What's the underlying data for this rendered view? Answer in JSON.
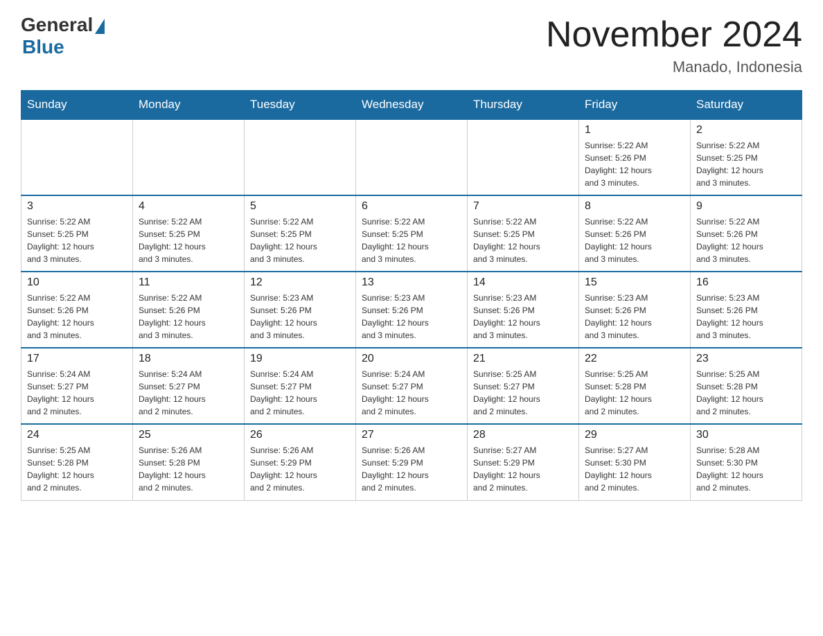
{
  "logo": {
    "general": "General",
    "blue": "Blue"
  },
  "title": {
    "month_year": "November 2024",
    "location": "Manado, Indonesia"
  },
  "header_days": [
    "Sunday",
    "Monday",
    "Tuesday",
    "Wednesday",
    "Thursday",
    "Friday",
    "Saturday"
  ],
  "weeks": [
    {
      "days": [
        {
          "num": "",
          "info": ""
        },
        {
          "num": "",
          "info": ""
        },
        {
          "num": "",
          "info": ""
        },
        {
          "num": "",
          "info": ""
        },
        {
          "num": "",
          "info": ""
        },
        {
          "num": "1",
          "info": "Sunrise: 5:22 AM\nSunset: 5:26 PM\nDaylight: 12 hours\nand 3 minutes."
        },
        {
          "num": "2",
          "info": "Sunrise: 5:22 AM\nSunset: 5:25 PM\nDaylight: 12 hours\nand 3 minutes."
        }
      ]
    },
    {
      "days": [
        {
          "num": "3",
          "info": "Sunrise: 5:22 AM\nSunset: 5:25 PM\nDaylight: 12 hours\nand 3 minutes."
        },
        {
          "num": "4",
          "info": "Sunrise: 5:22 AM\nSunset: 5:25 PM\nDaylight: 12 hours\nand 3 minutes."
        },
        {
          "num": "5",
          "info": "Sunrise: 5:22 AM\nSunset: 5:25 PM\nDaylight: 12 hours\nand 3 minutes."
        },
        {
          "num": "6",
          "info": "Sunrise: 5:22 AM\nSunset: 5:25 PM\nDaylight: 12 hours\nand 3 minutes."
        },
        {
          "num": "7",
          "info": "Sunrise: 5:22 AM\nSunset: 5:25 PM\nDaylight: 12 hours\nand 3 minutes."
        },
        {
          "num": "8",
          "info": "Sunrise: 5:22 AM\nSunset: 5:26 PM\nDaylight: 12 hours\nand 3 minutes."
        },
        {
          "num": "9",
          "info": "Sunrise: 5:22 AM\nSunset: 5:26 PM\nDaylight: 12 hours\nand 3 minutes."
        }
      ]
    },
    {
      "days": [
        {
          "num": "10",
          "info": "Sunrise: 5:22 AM\nSunset: 5:26 PM\nDaylight: 12 hours\nand 3 minutes."
        },
        {
          "num": "11",
          "info": "Sunrise: 5:22 AM\nSunset: 5:26 PM\nDaylight: 12 hours\nand 3 minutes."
        },
        {
          "num": "12",
          "info": "Sunrise: 5:23 AM\nSunset: 5:26 PM\nDaylight: 12 hours\nand 3 minutes."
        },
        {
          "num": "13",
          "info": "Sunrise: 5:23 AM\nSunset: 5:26 PM\nDaylight: 12 hours\nand 3 minutes."
        },
        {
          "num": "14",
          "info": "Sunrise: 5:23 AM\nSunset: 5:26 PM\nDaylight: 12 hours\nand 3 minutes."
        },
        {
          "num": "15",
          "info": "Sunrise: 5:23 AM\nSunset: 5:26 PM\nDaylight: 12 hours\nand 3 minutes."
        },
        {
          "num": "16",
          "info": "Sunrise: 5:23 AM\nSunset: 5:26 PM\nDaylight: 12 hours\nand 3 minutes."
        }
      ]
    },
    {
      "days": [
        {
          "num": "17",
          "info": "Sunrise: 5:24 AM\nSunset: 5:27 PM\nDaylight: 12 hours\nand 2 minutes."
        },
        {
          "num": "18",
          "info": "Sunrise: 5:24 AM\nSunset: 5:27 PM\nDaylight: 12 hours\nand 2 minutes."
        },
        {
          "num": "19",
          "info": "Sunrise: 5:24 AM\nSunset: 5:27 PM\nDaylight: 12 hours\nand 2 minutes."
        },
        {
          "num": "20",
          "info": "Sunrise: 5:24 AM\nSunset: 5:27 PM\nDaylight: 12 hours\nand 2 minutes."
        },
        {
          "num": "21",
          "info": "Sunrise: 5:25 AM\nSunset: 5:27 PM\nDaylight: 12 hours\nand 2 minutes."
        },
        {
          "num": "22",
          "info": "Sunrise: 5:25 AM\nSunset: 5:28 PM\nDaylight: 12 hours\nand 2 minutes."
        },
        {
          "num": "23",
          "info": "Sunrise: 5:25 AM\nSunset: 5:28 PM\nDaylight: 12 hours\nand 2 minutes."
        }
      ]
    },
    {
      "days": [
        {
          "num": "24",
          "info": "Sunrise: 5:25 AM\nSunset: 5:28 PM\nDaylight: 12 hours\nand 2 minutes."
        },
        {
          "num": "25",
          "info": "Sunrise: 5:26 AM\nSunset: 5:28 PM\nDaylight: 12 hours\nand 2 minutes."
        },
        {
          "num": "26",
          "info": "Sunrise: 5:26 AM\nSunset: 5:29 PM\nDaylight: 12 hours\nand 2 minutes."
        },
        {
          "num": "27",
          "info": "Sunrise: 5:26 AM\nSunset: 5:29 PM\nDaylight: 12 hours\nand 2 minutes."
        },
        {
          "num": "28",
          "info": "Sunrise: 5:27 AM\nSunset: 5:29 PM\nDaylight: 12 hours\nand 2 minutes."
        },
        {
          "num": "29",
          "info": "Sunrise: 5:27 AM\nSunset: 5:30 PM\nDaylight: 12 hours\nand 2 minutes."
        },
        {
          "num": "30",
          "info": "Sunrise: 5:28 AM\nSunset: 5:30 PM\nDaylight: 12 hours\nand 2 minutes."
        }
      ]
    }
  ]
}
